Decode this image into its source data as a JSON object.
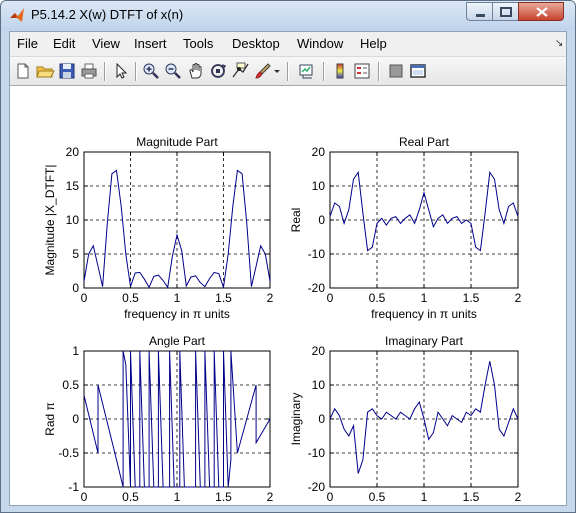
{
  "window": {
    "title": "P5.14.2 X(w) DTFT of x(n)"
  },
  "menu": [
    "File",
    "Edit",
    "View",
    "Insert",
    "Tools",
    "Desktop",
    "Window",
    "Help"
  ],
  "toolbar": {
    "buttons": [
      "new-file-icon",
      "open-folder-icon",
      "save-icon",
      "print-icon",
      "edit-plot-arrow-icon",
      "zoom-in-icon",
      "zoom-out-icon",
      "pan-hand-icon",
      "rotate-3d-icon",
      "data-cursor-icon",
      "brush-icon",
      "link-plot-icon",
      "insert-colorbar-icon",
      "insert-legend-icon",
      "hide-plot-tools-icon",
      "show-plot-tools-icon"
    ]
  },
  "figure_background": "#ffffff",
  "line_color": "#00008b",
  "chart_data": [
    {
      "type": "line",
      "title": "Magnitude Part",
      "xlabel": "frequency in π units",
      "ylabel": "Magnitude  |X_DTFT|",
      "xlim": [
        0,
        2
      ],
      "ylim": [
        0,
        20
      ],
      "xticks": [
        "0",
        "0.5",
        "1",
        "1.5",
        "2"
      ],
      "yticks": [
        "0",
        "5",
        "10",
        "15",
        "20"
      ],
      "grid": true,
      "series": [
        {
          "x": [
            0,
            0.05,
            0.1,
            0.15,
            0.2,
            0.25,
            0.3,
            0.35,
            0.4,
            0.45,
            0.5,
            0.55,
            0.6,
            0.65,
            0.7,
            0.75,
            0.8,
            0.85,
            0.9,
            0.95,
            1.0,
            1.05,
            1.1,
            1.15,
            1.2,
            1.25,
            1.3,
            1.35,
            1.4,
            1.45,
            1.5,
            1.55,
            1.6,
            1.65,
            1.7,
            1.75,
            1.8,
            1.85,
            1.9,
            1.95,
            2.0
          ],
          "y": [
            1,
            5,
            6.2,
            3.2,
            0.2,
            9.5,
            16.8,
            17.3,
            12,
            5,
            0.2,
            2.2,
            2.3,
            1.3,
            0.1,
            1.7,
            1.9,
            1.1,
            0.1,
            4.6,
            7.8,
            5.5,
            0.3,
            1.6,
            1.8,
            0.8,
            0.2,
            1.4,
            2.3,
            2.1,
            0.1,
            5,
            12,
            17.3,
            16.8,
            9.5,
            0.2,
            3.2,
            6.2,
            5,
            1
          ]
        }
      ]
    },
    {
      "type": "line",
      "title": "Real Part",
      "xlabel": "frequency in π units",
      "ylabel": "Real",
      "xlim": [
        0,
        2
      ],
      "ylim": [
        -20,
        20
      ],
      "xticks": [
        "0",
        "0.5",
        "1",
        "1.5",
        "2"
      ],
      "yticks": [
        "-20",
        "-10",
        "0",
        "10",
        "20"
      ],
      "grid": true,
      "series": [
        {
          "x": [
            0,
            0.05,
            0.1,
            0.15,
            0.2,
            0.25,
            0.3,
            0.35,
            0.4,
            0.45,
            0.5,
            0.55,
            0.6,
            0.65,
            0.7,
            0.75,
            0.8,
            0.85,
            0.9,
            0.95,
            1.0,
            1.05,
            1.1,
            1.15,
            1.2,
            1.25,
            1.3,
            1.35,
            1.4,
            1.45,
            1.5,
            1.55,
            1.6,
            1.65,
            1.7,
            1.75,
            1.8,
            1.85,
            1.9,
            1.95,
            2.0
          ],
          "y": [
            1,
            5,
            4,
            -1,
            3,
            12,
            14,
            2,
            -9,
            -8,
            -1,
            0.5,
            -1.5,
            0.5,
            1,
            -1,
            0.5,
            1.5,
            -1,
            3,
            8,
            3,
            -2,
            0.5,
            1.5,
            -1,
            0.5,
            1,
            -1,
            0,
            -1,
            -8,
            -9,
            2,
            14,
            12,
            3,
            -1,
            4,
            5,
            1
          ]
        }
      ]
    },
    {
      "type": "line",
      "title": "Angle Part",
      "xlabel": "frequency in π units",
      "ylabel": "Rad π",
      "xlim": [
        0,
        2
      ],
      "ylim": [
        -1,
        1
      ],
      "xticks": [
        "0",
        "0.5",
        "1",
        "1.5",
        "2"
      ],
      "yticks": [
        "-1",
        "-0.5",
        "0",
        "0.5",
        "1"
      ],
      "grid": true,
      "series": [
        {
          "x": [
            0,
            0.15,
            0.15,
            0.35,
            0.42,
            0.42,
            0.45,
            0.5,
            0.5,
            0.55,
            0.6,
            0.6,
            0.65,
            0.7,
            0.7,
            0.75,
            0.8,
            0.8,
            0.85,
            0.92,
            0.92,
            0.97,
            1.03,
            1.03,
            1.08,
            1.2,
            1.2,
            1.25,
            1.3,
            1.3,
            1.35,
            1.4,
            1.4,
            1.45,
            1.5,
            1.5,
            1.55,
            1.58,
            1.58,
            1.65,
            1.85,
            1.85,
            2.0
          ],
          "y": [
            0.35,
            -0.5,
            0.5,
            -0.6,
            -1,
            1,
            0.8,
            -1,
            1,
            -1,
            -1,
            1,
            -1,
            -1,
            1,
            -1,
            -1,
            1,
            -1,
            -1,
            1,
            -1,
            -1,
            1,
            -1,
            -1,
            1,
            -1,
            -1,
            1,
            -1,
            -1,
            1,
            -1,
            -1,
            1,
            -1,
            -0.6,
            1,
            -0.5,
            0.5,
            -0.35,
            0
          ]
        }
      ]
    },
    {
      "type": "line",
      "title": "Imaginary Part",
      "xlabel": "frequency in π units",
      "ylabel": "Imaginary",
      "xlim": [
        0,
        2
      ],
      "ylim": [
        -20,
        20
      ],
      "xticks": [
        "0",
        "0.5",
        "1",
        "1.5",
        "2"
      ],
      "yticks": [
        "-20",
        "-10",
        "0",
        "10",
        "20"
      ],
      "grid": true,
      "series": [
        {
          "x": [
            0,
            0.05,
            0.1,
            0.15,
            0.2,
            0.25,
            0.3,
            0.35,
            0.4,
            0.45,
            0.5,
            0.55,
            0.6,
            0.65,
            0.7,
            0.75,
            0.8,
            0.85,
            0.9,
            0.95,
            1.0,
            1.05,
            1.1,
            1.15,
            1.2,
            1.25,
            1.3,
            1.35,
            1.4,
            1.45,
            1.5,
            1.55,
            1.6,
            1.65,
            1.7,
            1.75,
            1.8,
            1.85,
            1.9,
            1.95,
            2.0
          ],
          "y": [
            0,
            3,
            1,
            -3,
            -5,
            -2,
            -16,
            -12,
            2,
            3,
            1,
            0,
            2,
            1,
            0,
            2,
            1,
            0,
            3,
            5,
            0,
            -6,
            -4,
            2,
            0,
            -2,
            1,
            0,
            -1,
            2,
            1,
            3,
            2,
            10,
            17,
            10,
            -3,
            -5,
            -1,
            3,
            0
          ]
        }
      ]
    }
  ]
}
